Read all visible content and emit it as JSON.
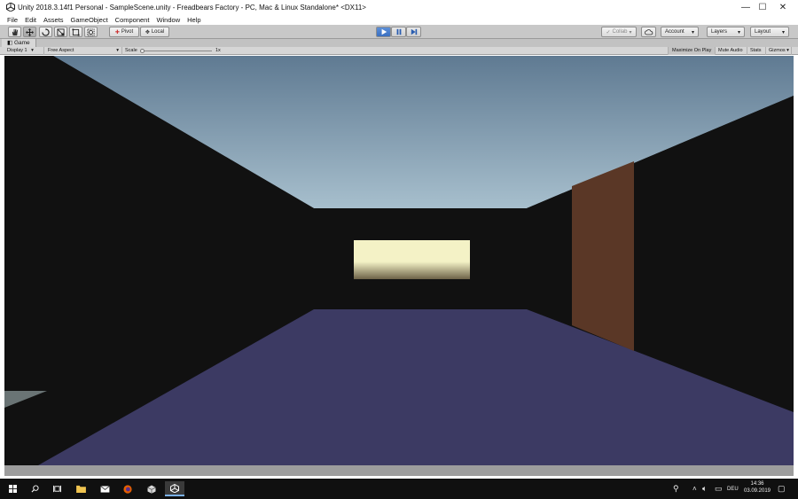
{
  "window": {
    "title": "Unity 2018.3.14f1 Personal - SampleScene.unity - Freadbears Factory - PC, Mac & Linux Standalone* <DX11>",
    "controls": [
      "—",
      "☐",
      "✕"
    ]
  },
  "menu": [
    "File",
    "Edit",
    "Assets",
    "GameObject",
    "Component",
    "Window",
    "Help"
  ],
  "toolbar": {
    "pivot_label": "Pivot",
    "local_label": "Local",
    "collab_label": "Collab",
    "account_label": "Account",
    "layers_label": "Layers",
    "layout_label": "Layout",
    "play_active": true
  },
  "game_panel": {
    "tab_label": "Game",
    "display": "Display 1",
    "aspect": "Free Aspect",
    "scale_label": "Scale",
    "scale_value": "1x",
    "maximize_on_play": "Maximize On Play",
    "mute_audio": "Mute Audio",
    "stats": "Stats",
    "gizmos": "Gizmos"
  },
  "scene_colors": {
    "sky_top": "#5f7a92",
    "sky_bottom": "#a7bfcd",
    "walls": "#111111",
    "floor": "#3c3a63",
    "door": "#5a3726",
    "window_light": "#f4f2c6"
  },
  "taskbar": {
    "language": "DEU",
    "time": "14:36",
    "date": "03.09.2019"
  }
}
